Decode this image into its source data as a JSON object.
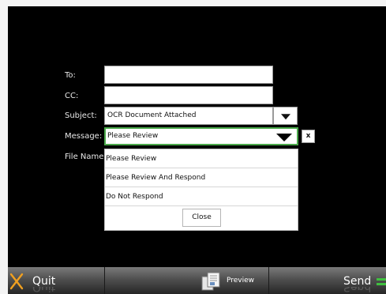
{
  "form": {
    "to_label": "To:",
    "cc_label": "CC:",
    "subject_label": "Subject:",
    "message_label": "Message:",
    "filename_label": "File Name:",
    "to_value": "",
    "cc_value": "",
    "subject_value": "OCR Document Attached",
    "message_value": "Please Review",
    "clear_label": "x"
  },
  "dropdown": {
    "options": [
      "Please Review",
      "Please Review And Respond",
      "Do Not Respond"
    ],
    "close_label": "Close"
  },
  "bottom_bar": {
    "quit_label": "Quit",
    "preview_label": "Preview",
    "send_label": "Send"
  },
  "colors": {
    "focus_border": "#4aa84a",
    "quit_icon": "#f0a020",
    "send_icon": "#3fbf3f"
  }
}
